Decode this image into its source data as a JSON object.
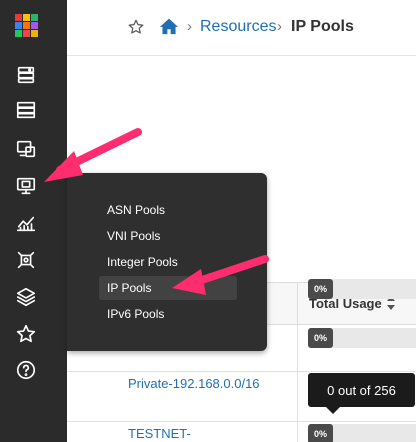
{
  "breadcrumb": {
    "parent": "Resources",
    "current": "IP Pools",
    "separator": "›"
  },
  "nav": {
    "logo_colors": [
      "#e23b3b",
      "#f4c20d",
      "#2fb26b",
      "#3b82f6",
      "#f97316",
      "#a855f7",
      "#22c55e",
      "#ef4444",
      "#eab308"
    ],
    "icons": [
      "blueprints-icon",
      "devices-icon",
      "design-icon",
      "resources-icon",
      "analytics-icon",
      "platform-icon",
      "layers-icon",
      "favorites-icon",
      "help-icon"
    ]
  },
  "flyout": {
    "items": [
      "ASN Pools",
      "VNI Pools",
      "Integer Pools",
      "IP Pools",
      "IPv6 Pools"
    ],
    "active_index": 3
  },
  "table": {
    "usage_header": "Total Usage",
    "rows": [
      {
        "name": "",
        "usage": "0%"
      },
      {
        "name": "",
        "usage": "0%"
      },
      {
        "name": "Private-192.168.0.0/16",
        "usage": "0%"
      },
      {
        "name": "TESTNET-",
        "usage": "0%"
      }
    ]
  },
  "tooltip": {
    "text": "0 out of 256"
  },
  "colors": {
    "rail": "#2b2b2b",
    "link": "#1f6fb2",
    "annotation": "#ff2d6f"
  }
}
